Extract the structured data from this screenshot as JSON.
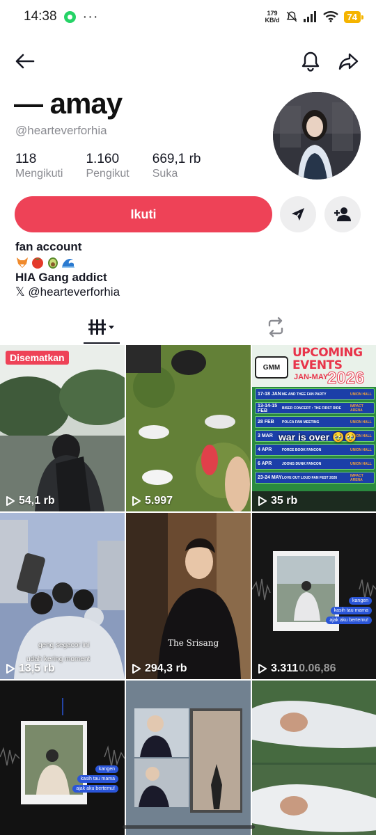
{
  "status_bar": {
    "time": "14:38",
    "net_speed_value": "179",
    "net_speed_unit": "KB/d",
    "battery": "74"
  },
  "profile": {
    "display_name": "— amay",
    "username": "@hearteverforhia",
    "stats": [
      {
        "value": "118",
        "label": "Mengikuti"
      },
      {
        "value": "1.160",
        "label": "Pengikut"
      },
      {
        "value": "669,1 rb",
        "label": "Suka"
      }
    ],
    "follow_label": "Ikuti",
    "bio": {
      "line1": "fan account",
      "emojis": [
        "fox-emoji",
        "tomato-emoji",
        "avocado-emoji",
        "wave-emoji"
      ],
      "line3": "HIA Gang addict",
      "line4": "𝕏 @hearteverforhia"
    }
  },
  "grid": [
    {
      "views": "54,1 rb",
      "pinned_label": "Disematkan"
    },
    {
      "views": "5.997"
    },
    {
      "views": "35 rb",
      "overlay_title": "UPCOMING EVENTS",
      "overlay_year": "2026",
      "overlay_sub": "JAN-MAY",
      "overlay_caption": "war is over 🥹🥹",
      "events": [
        {
          "date": "17-18 JAN",
          "name": "ME AND THEE FAN PARTY",
          "venue": "UNION HALL"
        },
        {
          "date": "13-14-15 FEB",
          "name": "BISER CONCERT : THE FIRST RIDE",
          "venue": "IMPACT ARENA"
        },
        {
          "date": "28 FEB",
          "name": "POLCA FAM MEETING",
          "venue": "UNION HALL"
        },
        {
          "date": "3 MAR",
          "name": "",
          "venue": "UNION HALL"
        },
        {
          "date": "4 APR",
          "name": "FORCE BOOK FANCON",
          "venue": "UNION HALL"
        },
        {
          "date": "6 APR",
          "name": "JOONG DUNK FANCON",
          "venue": "UNION HALL"
        },
        {
          "date": "23-24 MAY",
          "name": "LOVE OUT LOUD FAN FEST 2026",
          "venue": "IMPACT ARENA"
        }
      ]
    },
    {
      "views": "13,5 rb",
      "caption1": "geng segacor ini",
      "caption2": "udah kering moment"
    },
    {
      "views": "294,3 rb",
      "brand": "The Srisang"
    },
    {
      "views": "3.311",
      "timestamp": "0.06,86",
      "chat": [
        "kangen",
        "kasih tau mama",
        "ajak aku bertemu!"
      ]
    },
    {
      "views": "",
      "chat": [
        "kangen",
        "kasih tau mama",
        "ajak aku bertemu!"
      ]
    },
    {
      "views": ""
    },
    {
      "views": ""
    }
  ]
}
